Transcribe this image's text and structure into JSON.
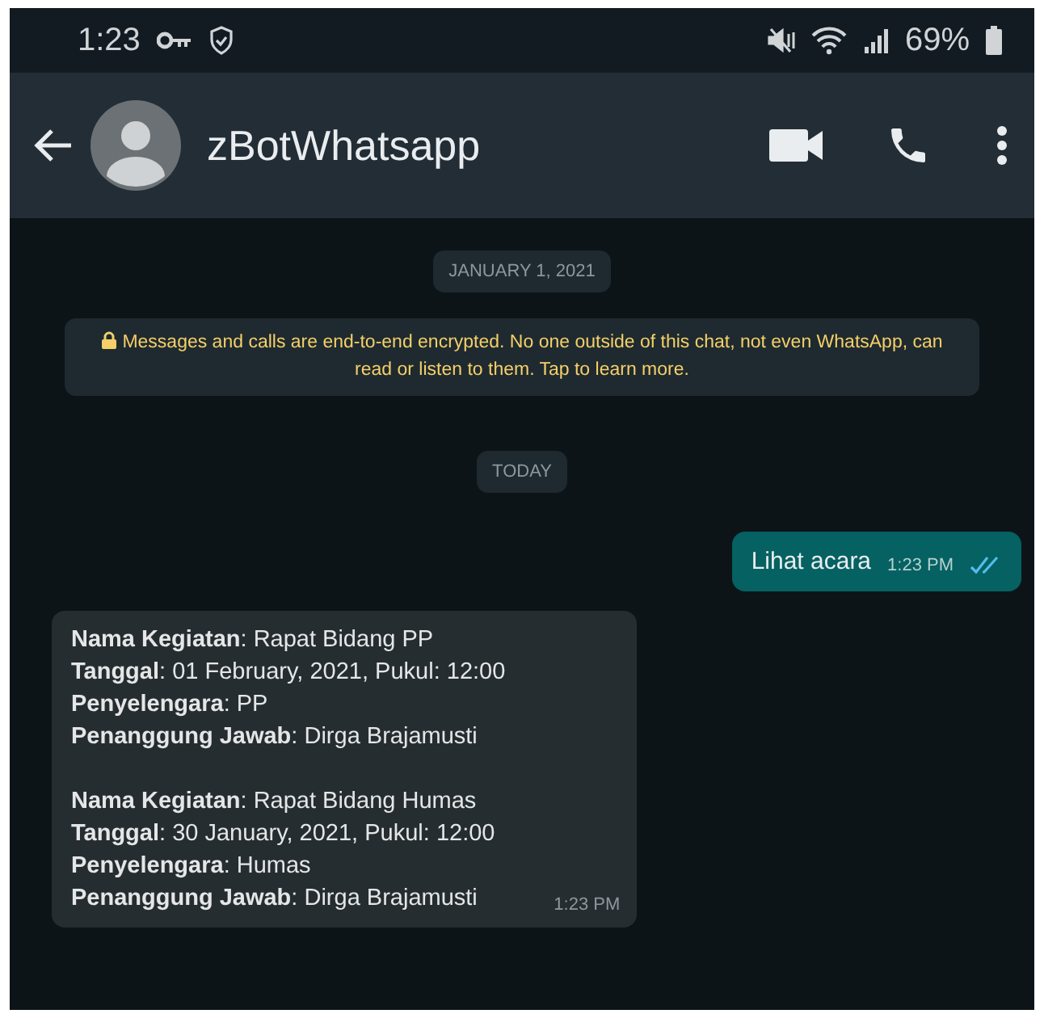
{
  "status_bar": {
    "time": "1:23",
    "battery": "69%"
  },
  "header": {
    "title": "zBotWhatsapp"
  },
  "chat": [
    {
      "kind": "date",
      "text": "JANUARY 1, 2021"
    },
    {
      "kind": "notice",
      "text": "Messages and calls are end-to-end encrypted. No one outside of this chat, not even WhatsApp, can read or listen to them. Tap to learn more."
    },
    {
      "kind": "date",
      "text": "TODAY"
    },
    {
      "kind": "outgoing",
      "text": "Lihat acara",
      "time": "1:23 PM",
      "read": true
    },
    {
      "kind": "incoming",
      "time": "1:23 PM",
      "blocks": [
        [
          "**Nama Kegiatan**: Rapat Bidang PP",
          "**Tanggal**: 01 February, 2021, Pukul: 12:00",
          "**Penyelengara**: PP",
          "**Penanggung Jawab**: Dirga Brajamusti"
        ],
        [
          "**Nama Kegiatan**: Rapat Bidang Humas",
          "**Tanggal**: 30 January, 2021, Pukul: 12:00",
          "**Penyelengara**: Humas",
          "**Penanggung Jawab**: Dirga Brajamusti"
        ]
      ]
    }
  ]
}
